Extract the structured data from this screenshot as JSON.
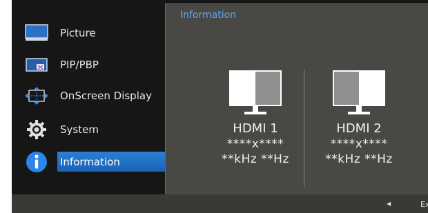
{
  "menu": {
    "items": [
      {
        "label": "Picture",
        "icon": "monitor-icon"
      },
      {
        "label": "PIP/PBP",
        "icon": "pip-icon"
      },
      {
        "label": "OnScreen Display",
        "icon": "osd-move-icon"
      },
      {
        "label": "System",
        "icon": "gear-icon"
      },
      {
        "label": "Information",
        "icon": "info-icon"
      }
    ],
    "active": "Information"
  },
  "panel": {
    "title": "Information",
    "sources": [
      {
        "name": "HDMI 1",
        "resolution": "****x****",
        "frequency": "**kHz **Hz",
        "screen_colors": [
          "#ffffff",
          "#8f8f8f"
        ]
      },
      {
        "name": "HDMI 2",
        "resolution": "****x****",
        "frequency": "**kHz **Hz",
        "screen_colors": [
          "#8f8f8f",
          "#ffffff"
        ]
      }
    ]
  },
  "footer": {
    "exit_label": "Ex",
    "exit_icon": "left-arrow-icon"
  },
  "colors": {
    "accent": "#5fa9f0",
    "active_bg": "#1a63b5",
    "panel_bg": "#4a4844",
    "osd_bg": "#161616"
  }
}
